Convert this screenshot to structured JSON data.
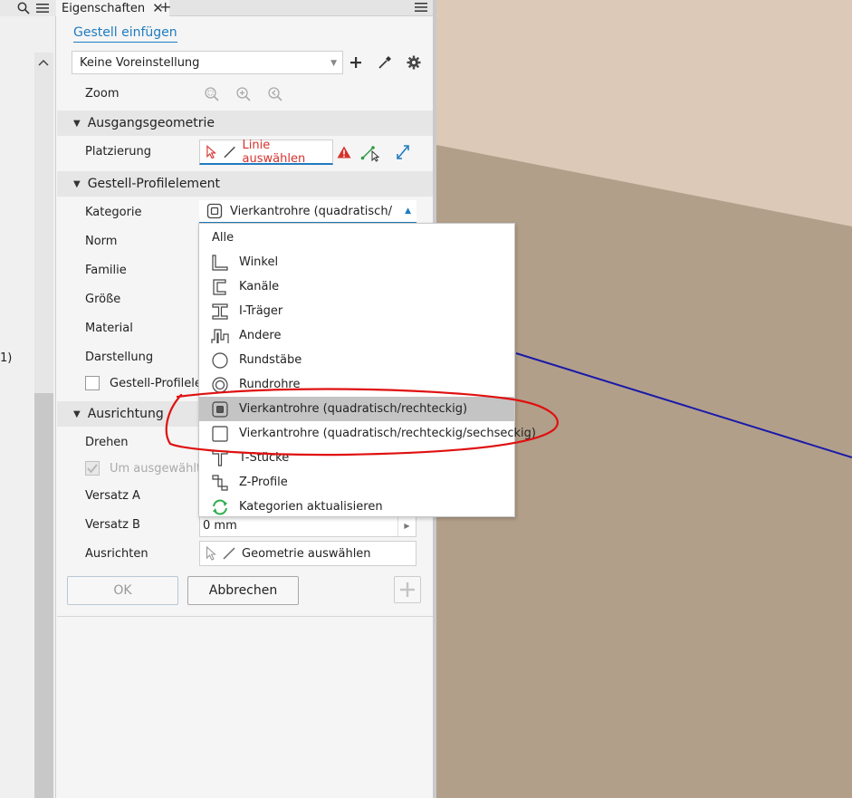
{
  "left_strip": {
    "cut_text": "1)"
  },
  "tab": {
    "title": "Eigenschaften"
  },
  "panel": {
    "link_title": "Gestell einfügen",
    "preset_value": "Keine Voreinstellung",
    "zoom_label": "Zoom",
    "section_input": "Ausgangsgeometrie",
    "placement_label": "Platzierung",
    "placement_value": "Linie auswählen",
    "section_profile": "Gestell-Profilelement",
    "category_label": "Kategorie",
    "category_value": "Vierkantrohre (quadratisch/rechteckig)",
    "norm_label": "Norm",
    "family_label": "Familie",
    "size_label": "Größe",
    "material_label": "Material",
    "appearance_label": "Darstellung",
    "member_checkbox_label": "Gestell-Profilelement",
    "section_orientation": "Ausrichtung",
    "rotate_label": "Drehen",
    "selected_checkbox_label": "Um ausgewählte",
    "offset_a_label": "Versatz A",
    "offset_b_label": "Versatz B",
    "offset_b_value": "0 mm",
    "align_label": "Ausrichten",
    "align_value": "Geometrie auswählen",
    "ok_label": "OK",
    "cancel_label": "Abbrechen"
  },
  "dropdown": {
    "items": [
      {
        "label": "Alle",
        "icon": "none"
      },
      {
        "label": "Winkel",
        "icon": "angle-icon"
      },
      {
        "label": "Kanäle",
        "icon": "channel-icon"
      },
      {
        "label": "I-Träger",
        "icon": "i-beam-icon"
      },
      {
        "label": "Andere",
        "icon": "other-profile-icon"
      },
      {
        "label": "Rundstäbe",
        "icon": "round-bar-icon"
      },
      {
        "label": "Rundrohre",
        "icon": "round-tube-icon"
      },
      {
        "label": "Vierkantrohre (quadratisch/rechteckig)",
        "icon": "square-tube-icon",
        "selected": true
      },
      {
        "label": "Vierkantrohre (quadratisch/rechteckig/sechseckig)",
        "icon": "square-bar-icon"
      },
      {
        "label": "T-Stücke",
        "icon": "t-profile-icon"
      },
      {
        "label": "Z-Profile",
        "icon": "z-profile-icon"
      },
      {
        "label": "Kategorien aktualisieren",
        "icon": "refresh-icon"
      }
    ]
  },
  "colors": {
    "accent": "#1f7bbf",
    "warning": "#d6322d",
    "annotation": "#e01010",
    "viewport_light": "#dcc9b8",
    "viewport_dark": "#b29f8a",
    "line": "#1a1aa8"
  }
}
